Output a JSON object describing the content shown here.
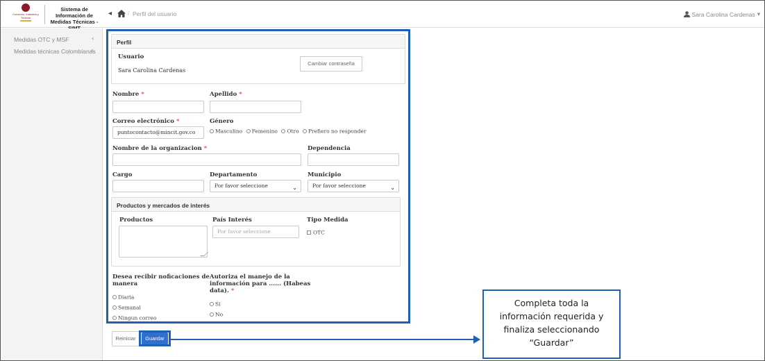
{
  "header": {
    "logo_text": "Comercio, Industria y Turismo",
    "brand_title": "Sistema de Información de Medidas Técnicas - SIMT",
    "breadcrumb": "Perfil del usuario",
    "user_name": "Sara Carolina Cardenas",
    "user_caret": "▾"
  },
  "sidebar": {
    "items": [
      {
        "label": "Medidas OTC y MSF",
        "chevron": "‹"
      },
      {
        "label": "Medidas técnicas Colombianas",
        "chevron": "‹"
      }
    ]
  },
  "profile_panel": {
    "title": "Perfil",
    "usuario_label": "Usuario",
    "usuario_value": "Sara Carolina Cardenas",
    "change_password_button": "Cambiar contraseña"
  },
  "form": {
    "nombre_label": "Nombre",
    "apellido_label": "Apellido",
    "correo_label": "Correo electrónico",
    "correo_value": "puntocontacto@mincit.gov.co",
    "genero_label": "Género",
    "genero_options": [
      "Masculino",
      "Femenino",
      "Otro",
      "Prefiero no responder"
    ],
    "organizacion_label": "Nombre de la organizacion",
    "dependencia_label": "Dependencia",
    "cargo_label": "Cargo",
    "departamento_label": "Departamento",
    "departamento_value": "Por favor seleccione",
    "municipio_label": "Municipio",
    "municipio_value": "Por favor seleccione",
    "required_mark": "*"
  },
  "products_panel": {
    "title": "Productos y mercados de interés",
    "productos_label": "Productos",
    "pais_label": "País Interés",
    "pais_placeholder": "Por favor seleccione",
    "tipo_label": "Tipo Medida",
    "tipo_option": "OTC"
  },
  "notifications": {
    "label_line1": "Desea recibir noficaciones de",
    "label_line2": "manera",
    "options": [
      "Diaria",
      "Semanal",
      "Ningun correo"
    ]
  },
  "habeas": {
    "label_line1": "Autoriza el manejo de la",
    "label_line2": "información para ...... (Habeas",
    "label_line3": "data).",
    "options": [
      "Si",
      "No"
    ]
  },
  "actions": {
    "reset_button": "Reiniciar",
    "save_button": "Guardar"
  },
  "callout": {
    "line1": "Completa toda la",
    "line2": "información requerida y",
    "line3": "finaliza seleccionando",
    "line4": "“Guardar”"
  },
  "colors": {
    "highlight": "#1f5fb4",
    "primary_button": "#2f6fd0",
    "required": "#d9534f"
  }
}
